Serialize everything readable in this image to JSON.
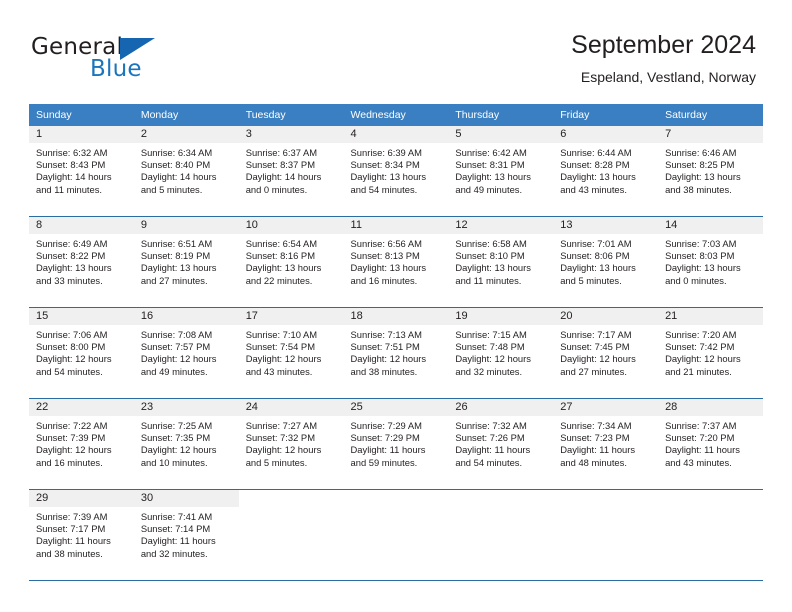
{
  "brand": {
    "name_part1": "General",
    "name_part2": "Blue",
    "flag_icon": "triangle-flag-icon"
  },
  "header": {
    "title": "September 2024",
    "location": "Espeland, Vestland, Norway"
  },
  "colors": {
    "header_blue": "#3a7fc1",
    "rule_blue": "#2b6ca3",
    "daynum_band": "#f0f0f0",
    "brand_blue": "#1b75bc",
    "text": "#231f20"
  },
  "calendar": {
    "weekday_headers": [
      "Sunday",
      "Monday",
      "Tuesday",
      "Wednesday",
      "Thursday",
      "Friday",
      "Saturday"
    ],
    "weeks": [
      [
        {
          "day": "1",
          "sunrise": "Sunrise: 6:32 AM",
          "sunset": "Sunset: 8:43 PM",
          "daylight1": "Daylight: 14 hours",
          "daylight2": "and 11 minutes."
        },
        {
          "day": "2",
          "sunrise": "Sunrise: 6:34 AM",
          "sunset": "Sunset: 8:40 PM",
          "daylight1": "Daylight: 14 hours",
          "daylight2": "and 5 minutes."
        },
        {
          "day": "3",
          "sunrise": "Sunrise: 6:37 AM",
          "sunset": "Sunset: 8:37 PM",
          "daylight1": "Daylight: 14 hours",
          "daylight2": "and 0 minutes."
        },
        {
          "day": "4",
          "sunrise": "Sunrise: 6:39 AM",
          "sunset": "Sunset: 8:34 PM",
          "daylight1": "Daylight: 13 hours",
          "daylight2": "and 54 minutes."
        },
        {
          "day": "5",
          "sunrise": "Sunrise: 6:42 AM",
          "sunset": "Sunset: 8:31 PM",
          "daylight1": "Daylight: 13 hours",
          "daylight2": "and 49 minutes."
        },
        {
          "day": "6",
          "sunrise": "Sunrise: 6:44 AM",
          "sunset": "Sunset: 8:28 PM",
          "daylight1": "Daylight: 13 hours",
          "daylight2": "and 43 minutes."
        },
        {
          "day": "7",
          "sunrise": "Sunrise: 6:46 AM",
          "sunset": "Sunset: 8:25 PM",
          "daylight1": "Daylight: 13 hours",
          "daylight2": "and 38 minutes."
        }
      ],
      [
        {
          "day": "8",
          "sunrise": "Sunrise: 6:49 AM",
          "sunset": "Sunset: 8:22 PM",
          "daylight1": "Daylight: 13 hours",
          "daylight2": "and 33 minutes."
        },
        {
          "day": "9",
          "sunrise": "Sunrise: 6:51 AM",
          "sunset": "Sunset: 8:19 PM",
          "daylight1": "Daylight: 13 hours",
          "daylight2": "and 27 minutes."
        },
        {
          "day": "10",
          "sunrise": "Sunrise: 6:54 AM",
          "sunset": "Sunset: 8:16 PM",
          "daylight1": "Daylight: 13 hours",
          "daylight2": "and 22 minutes."
        },
        {
          "day": "11",
          "sunrise": "Sunrise: 6:56 AM",
          "sunset": "Sunset: 8:13 PM",
          "daylight1": "Daylight: 13 hours",
          "daylight2": "and 16 minutes."
        },
        {
          "day": "12",
          "sunrise": "Sunrise: 6:58 AM",
          "sunset": "Sunset: 8:10 PM",
          "daylight1": "Daylight: 13 hours",
          "daylight2": "and 11 minutes."
        },
        {
          "day": "13",
          "sunrise": "Sunrise: 7:01 AM",
          "sunset": "Sunset: 8:06 PM",
          "daylight1": "Daylight: 13 hours",
          "daylight2": "and 5 minutes."
        },
        {
          "day": "14",
          "sunrise": "Sunrise: 7:03 AM",
          "sunset": "Sunset: 8:03 PM",
          "daylight1": "Daylight: 13 hours",
          "daylight2": "and 0 minutes."
        }
      ],
      [
        {
          "day": "15",
          "sunrise": "Sunrise: 7:06 AM",
          "sunset": "Sunset: 8:00 PM",
          "daylight1": "Daylight: 12 hours",
          "daylight2": "and 54 minutes."
        },
        {
          "day": "16",
          "sunrise": "Sunrise: 7:08 AM",
          "sunset": "Sunset: 7:57 PM",
          "daylight1": "Daylight: 12 hours",
          "daylight2": "and 49 minutes."
        },
        {
          "day": "17",
          "sunrise": "Sunrise: 7:10 AM",
          "sunset": "Sunset: 7:54 PM",
          "daylight1": "Daylight: 12 hours",
          "daylight2": "and 43 minutes."
        },
        {
          "day": "18",
          "sunrise": "Sunrise: 7:13 AM",
          "sunset": "Sunset: 7:51 PM",
          "daylight1": "Daylight: 12 hours",
          "daylight2": "and 38 minutes."
        },
        {
          "day": "19",
          "sunrise": "Sunrise: 7:15 AM",
          "sunset": "Sunset: 7:48 PM",
          "daylight1": "Daylight: 12 hours",
          "daylight2": "and 32 minutes."
        },
        {
          "day": "20",
          "sunrise": "Sunrise: 7:17 AM",
          "sunset": "Sunset: 7:45 PM",
          "daylight1": "Daylight: 12 hours",
          "daylight2": "and 27 minutes."
        },
        {
          "day": "21",
          "sunrise": "Sunrise: 7:20 AM",
          "sunset": "Sunset: 7:42 PM",
          "daylight1": "Daylight: 12 hours",
          "daylight2": "and 21 minutes."
        }
      ],
      [
        {
          "day": "22",
          "sunrise": "Sunrise: 7:22 AM",
          "sunset": "Sunset: 7:39 PM",
          "daylight1": "Daylight: 12 hours",
          "daylight2": "and 16 minutes."
        },
        {
          "day": "23",
          "sunrise": "Sunrise: 7:25 AM",
          "sunset": "Sunset: 7:35 PM",
          "daylight1": "Daylight: 12 hours",
          "daylight2": "and 10 minutes."
        },
        {
          "day": "24",
          "sunrise": "Sunrise: 7:27 AM",
          "sunset": "Sunset: 7:32 PM",
          "daylight1": "Daylight: 12 hours",
          "daylight2": "and 5 minutes."
        },
        {
          "day": "25",
          "sunrise": "Sunrise: 7:29 AM",
          "sunset": "Sunset: 7:29 PM",
          "daylight1": "Daylight: 11 hours",
          "daylight2": "and 59 minutes."
        },
        {
          "day": "26",
          "sunrise": "Sunrise: 7:32 AM",
          "sunset": "Sunset: 7:26 PM",
          "daylight1": "Daylight: 11 hours",
          "daylight2": "and 54 minutes."
        },
        {
          "day": "27",
          "sunrise": "Sunrise: 7:34 AM",
          "sunset": "Sunset: 7:23 PM",
          "daylight1": "Daylight: 11 hours",
          "daylight2": "and 48 minutes."
        },
        {
          "day": "28",
          "sunrise": "Sunrise: 7:37 AM",
          "sunset": "Sunset: 7:20 PM",
          "daylight1": "Daylight: 11 hours",
          "daylight2": "and 43 minutes."
        }
      ],
      [
        {
          "day": "29",
          "sunrise": "Sunrise: 7:39 AM",
          "sunset": "Sunset: 7:17 PM",
          "daylight1": "Daylight: 11 hours",
          "daylight2": "and 38 minutes."
        },
        {
          "day": "30",
          "sunrise": "Sunrise: 7:41 AM",
          "sunset": "Sunset: 7:14 PM",
          "daylight1": "Daylight: 11 hours",
          "daylight2": "and 32 minutes."
        },
        {
          "day": "",
          "sunrise": "",
          "sunset": "",
          "daylight1": "",
          "daylight2": ""
        },
        {
          "day": "",
          "sunrise": "",
          "sunset": "",
          "daylight1": "",
          "daylight2": ""
        },
        {
          "day": "",
          "sunrise": "",
          "sunset": "",
          "daylight1": "",
          "daylight2": ""
        },
        {
          "day": "",
          "sunrise": "",
          "sunset": "",
          "daylight1": "",
          "daylight2": ""
        },
        {
          "day": "",
          "sunrise": "",
          "sunset": "",
          "daylight1": "",
          "daylight2": ""
        }
      ]
    ]
  }
}
